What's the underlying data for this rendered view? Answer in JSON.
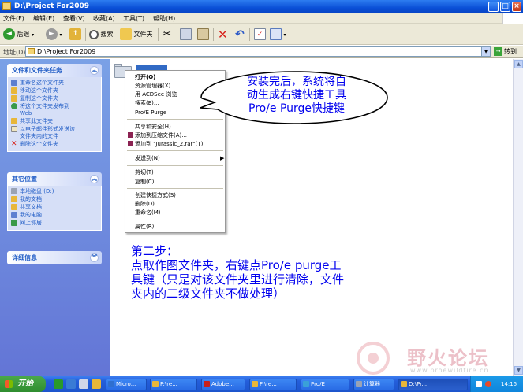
{
  "window": {
    "title": "D:\\Project For2009"
  },
  "menubar": [
    "文件(F)",
    "编辑(E)",
    "查看(V)",
    "收藏(A)",
    "工具(T)",
    "帮助(H)"
  ],
  "toolbar": {
    "back": "后退",
    "search": "搜索",
    "folders": "文件夹"
  },
  "address": {
    "label": "地址(D)",
    "value": "D:\\Project For2009",
    "go": "转到"
  },
  "left_panel": {
    "tasks": {
      "title": "文件和文件夹任务",
      "items": [
        "重命名这个文件夹",
        "移动这个文件夹",
        "复制这个文件夹",
        "将这个文件夹发布到\nWeb",
        "共享此文件夹",
        "以电子邮件形式发送该\n文件夹内的文件",
        "删除这个文件夹"
      ]
    },
    "places": {
      "title": "其它位置",
      "items": [
        "本地磁盘 (D:)",
        "我的文档",
        "共享文档",
        "我的电脑",
        "网上邻居"
      ]
    },
    "details": {
      "title": "详细信息"
    }
  },
  "context_menu": [
    {
      "label": "打开(O)",
      "bold": true
    },
    {
      "label": "资源管理器(X)"
    },
    {
      "label": "用 ACDSee 浏览"
    },
    {
      "label": "搜索(E)..."
    },
    {
      "label": "Pro/E Purge"
    },
    {
      "separator": true
    },
    {
      "label": "共享和安全(H)..."
    },
    {
      "label": "添加到压缩文件(A)..."
    },
    {
      "label": "添加到 \"Jurassic_2.rar\"(T)"
    },
    {
      "separator": true
    },
    {
      "label": "发送到(N)",
      "submenu": true
    },
    {
      "separator": true
    },
    {
      "label": "剪切(T)"
    },
    {
      "label": "复制(C)"
    },
    {
      "separator": true
    },
    {
      "label": "创建快捷方式(S)"
    },
    {
      "label": "删除(D)"
    },
    {
      "label": "重命名(M)"
    },
    {
      "separator": true
    },
    {
      "label": "属性(R)"
    }
  ],
  "annotation": {
    "bubble": [
      "安装完后，系统将自",
      "动生成右键快捷工具",
      "Pro/e Purge快捷键"
    ],
    "step": [
      "第二步：",
      "点取作图文件夹，右键点Pro/e purge工",
      "具键（只是对该文件夹里进行清除，文件",
      "夹内的二级文件夹不做处理）"
    ]
  },
  "watermark": {
    "title": "野火论坛",
    "url": "www.proewildfire.cn"
  },
  "taskbar": {
    "start": "开始",
    "tasks": [
      "Micro...",
      "F:\\re...",
      "Adobe...",
      "F:\\re...",
      "Pro/E",
      "计算器",
      "D:\\Pr..."
    ],
    "clock": "14:15"
  },
  "colors": {
    "title_blue": "#0a4fd6",
    "annotation_blue": "#0000ee",
    "taskpane_blue": "#215dc6"
  }
}
